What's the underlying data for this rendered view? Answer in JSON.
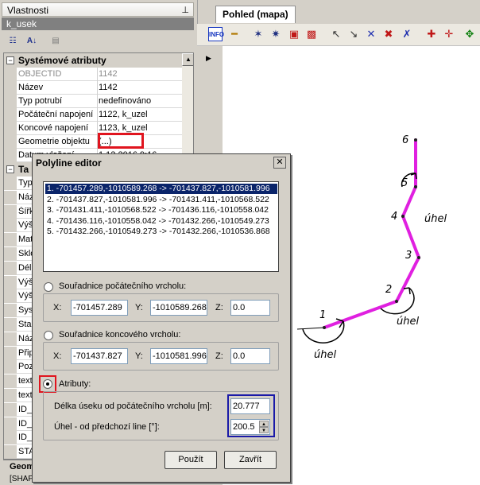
{
  "properties": {
    "title": "Vlastnosti",
    "object_name": "k_usek",
    "categories": {
      "system": "Systémové atributy",
      "second": "Ta"
    },
    "rows": [
      {
        "label": "OBJECTID",
        "value": "1142",
        "grey": true
      },
      {
        "label": "Název",
        "value": "1142"
      },
      {
        "label": "Typ potrubí",
        "value": "nedefinováno"
      },
      {
        "label": "Počáteční napojení",
        "value": "1122, k_uzel"
      },
      {
        "label": "Koncové napojení",
        "value": "1123, k_uzel"
      },
      {
        "label": "Geometrie objektu",
        "value": "(...)"
      },
      {
        "label": "Datum vložení",
        "value": "1.12.2016 9:16"
      }
    ],
    "second_rows": [
      "Typ",
      "Náz",
      "Šířk",
      "Výš",
      "Mat",
      "Sklo",
      "Dél",
      "Výš",
      "Výš",
      "Sys",
      "Sta",
      "Náz",
      "Přip",
      "Poz",
      "text",
      "text",
      "ID_",
      "ID_",
      "ID_",
      "STA"
    ],
    "geom_title": "Geom",
    "geom_sub": "[SHAP"
  },
  "map": {
    "tab_label": "Pohled (mapa)",
    "vertex_labels": [
      "1",
      "2",
      "3",
      "4",
      "5",
      "6"
    ],
    "angle_label": "úhel",
    "line_color": "#e020e0"
  },
  "dialog": {
    "title": "Polyline editor",
    "segments": [
      "1. -701457.289,-1010589.268 -> -701437.827,-1010581.996",
      "2. -701437.827,-1010581.996 -> -701431.411,-1010568.522",
      "3. -701431.411,-1010568.522 -> -701436.116,-1010558.042",
      "4. -701436.116,-1010558.042 -> -701432.266,-1010549.273",
      "5. -701432.266,-1010549.273 -> -701432.266,-1010536.868"
    ],
    "start_label": "Souřadnice počátečního vrcholu:",
    "start": {
      "x": "-701457.289",
      "y": "-1010589.268",
      "z": "0.0"
    },
    "end_label": "Souřadnice koncového vrcholu:",
    "end": {
      "x": "-701437.827",
      "y": "-1010581.996",
      "z": "0.0"
    },
    "x_label": "X:",
    "y_label": "Y:",
    "z_label": "Z:",
    "attr_label": "Atributy:",
    "length_label": "Délka úseku od počátečního vrcholu [m]:",
    "length_value": "20.777",
    "angle_label": "Úhel - od předchozí line [°]:",
    "angle_value": "200.5",
    "apply_label": "Použít",
    "close_label": "Zavřít"
  }
}
